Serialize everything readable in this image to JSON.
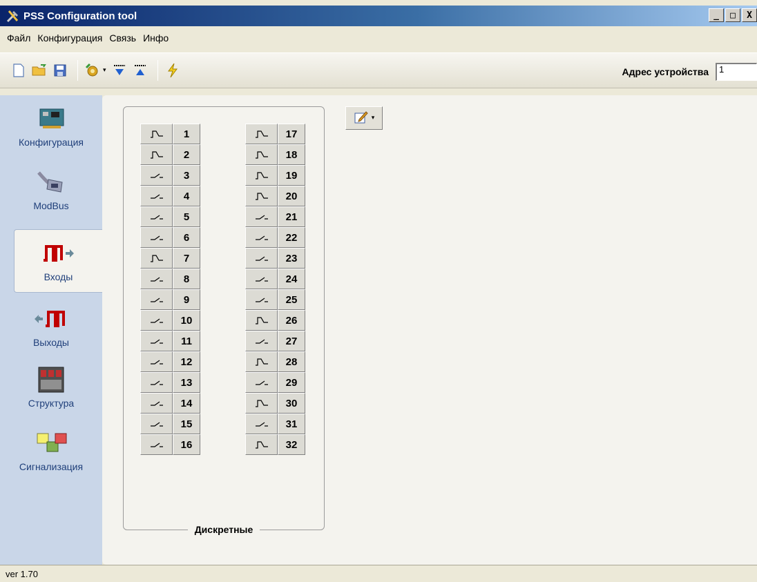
{
  "window": {
    "title": "PSS Configuration tool",
    "minimize": "_",
    "maximize": "□",
    "close": "X"
  },
  "menu": [
    "Файл",
    "Конфигурация",
    "Связь",
    "Инфо"
  ],
  "toolbar": {
    "icons": [
      "new-file-icon",
      "open-folder-icon",
      "save-disk-icon",
      "settings-gear-icon",
      "download-icon",
      "upload-icon",
      "lightning-icon"
    ],
    "dropdown_arrow": "▾",
    "address_label": "Адрес устройства",
    "address_value": "1"
  },
  "nav": [
    {
      "label": "Конфигурация",
      "icon": "board-icon",
      "active": false
    },
    {
      "label": "ModBus",
      "icon": "cable-connector-icon",
      "active": false
    },
    {
      "label": "Входы",
      "icon": "inputs-pulse-icon",
      "active": true
    },
    {
      "label": "Выходы",
      "icon": "outputs-pulse-icon",
      "active": false
    },
    {
      "label": "Структура",
      "icon": "structure-rack-icon",
      "active": false
    },
    {
      "label": "Сигнализация",
      "icon": "alarm-blocks-icon",
      "active": false
    }
  ],
  "inputs": {
    "group_label": "Дискретные",
    "symbols": {
      "pulse": "⌐ˉ↘",
      "contact": "-⁄-"
    },
    "left": [
      {
        "num": "1",
        "type": "pulse"
      },
      {
        "num": "2",
        "type": "pulse"
      },
      {
        "num": "3",
        "type": "contact"
      },
      {
        "num": "4",
        "type": "contact"
      },
      {
        "num": "5",
        "type": "contact"
      },
      {
        "num": "6",
        "type": "contact"
      },
      {
        "num": "7",
        "type": "pulse"
      },
      {
        "num": "8",
        "type": "contact"
      },
      {
        "num": "9",
        "type": "contact"
      },
      {
        "num": "10",
        "type": "contact"
      },
      {
        "num": "11",
        "type": "contact"
      },
      {
        "num": "12",
        "type": "contact"
      },
      {
        "num": "13",
        "type": "contact"
      },
      {
        "num": "14",
        "type": "contact"
      },
      {
        "num": "15",
        "type": "contact"
      },
      {
        "num": "16",
        "type": "contact"
      }
    ],
    "right": [
      {
        "num": "17",
        "type": "pulse"
      },
      {
        "num": "18",
        "type": "pulse"
      },
      {
        "num": "19",
        "type": "pulse"
      },
      {
        "num": "20",
        "type": "pulse"
      },
      {
        "num": "21",
        "type": "contact"
      },
      {
        "num": "22",
        "type": "contact"
      },
      {
        "num": "23",
        "type": "contact"
      },
      {
        "num": "24",
        "type": "contact"
      },
      {
        "num": "25",
        "type": "contact"
      },
      {
        "num": "26",
        "type": "pulse"
      },
      {
        "num": "27",
        "type": "contact"
      },
      {
        "num": "28",
        "type": "pulse"
      },
      {
        "num": "29",
        "type": "contact"
      },
      {
        "num": "30",
        "type": "pulse"
      },
      {
        "num": "31",
        "type": "contact"
      },
      {
        "num": "32",
        "type": "pulse"
      }
    ]
  },
  "edit_button": {
    "icon": "edit-pencil-icon",
    "arrow": "▾"
  },
  "status": {
    "version": "ver 1.70"
  }
}
